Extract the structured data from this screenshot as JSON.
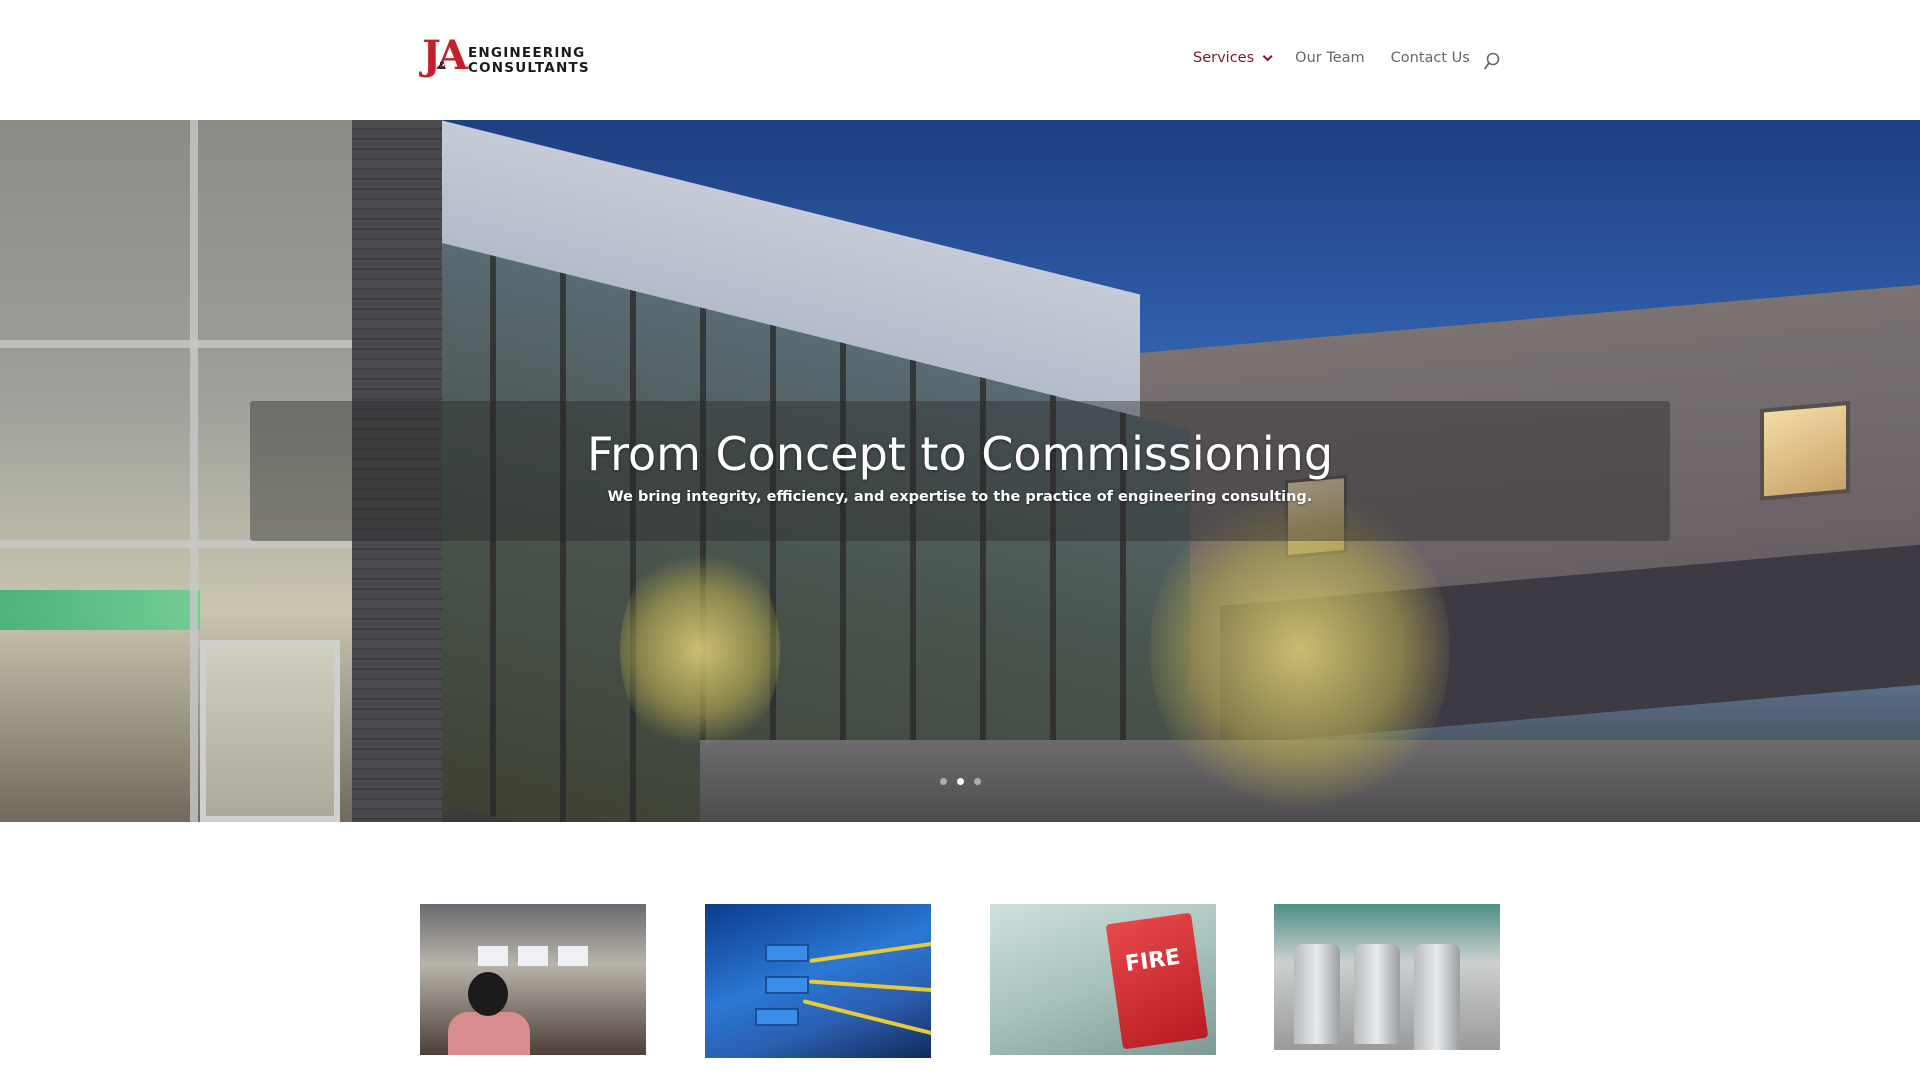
{
  "header": {
    "logo": {
      "mark": "J&A",
      "line1": "ENGINEERING",
      "line2": "CONSULTANTS"
    },
    "nav": [
      {
        "label": "Services",
        "active": true,
        "has_dropdown": true
      },
      {
        "label": "Our Team",
        "active": false
      },
      {
        "label": "Contact Us",
        "active": false
      }
    ],
    "search_icon": "search-icon"
  },
  "hero": {
    "title": "From Concept to Commissioning",
    "subtitle": "We bring integrity, efficiency, and expertise to the practice of engineering consulting.",
    "slides": 3,
    "active_slide": 2
  },
  "services": {
    "images": [
      {
        "name": "auditorium-image"
      },
      {
        "name": "network-cables-image"
      },
      {
        "name": "fire-alarm-image"
      },
      {
        "name": "security-turnstiles-image"
      }
    ],
    "fire_label": "FIRE"
  },
  "colors": {
    "brand_red": "#c4202a",
    "nav_active": "#7a1a2a",
    "nav_text": "#666666"
  }
}
